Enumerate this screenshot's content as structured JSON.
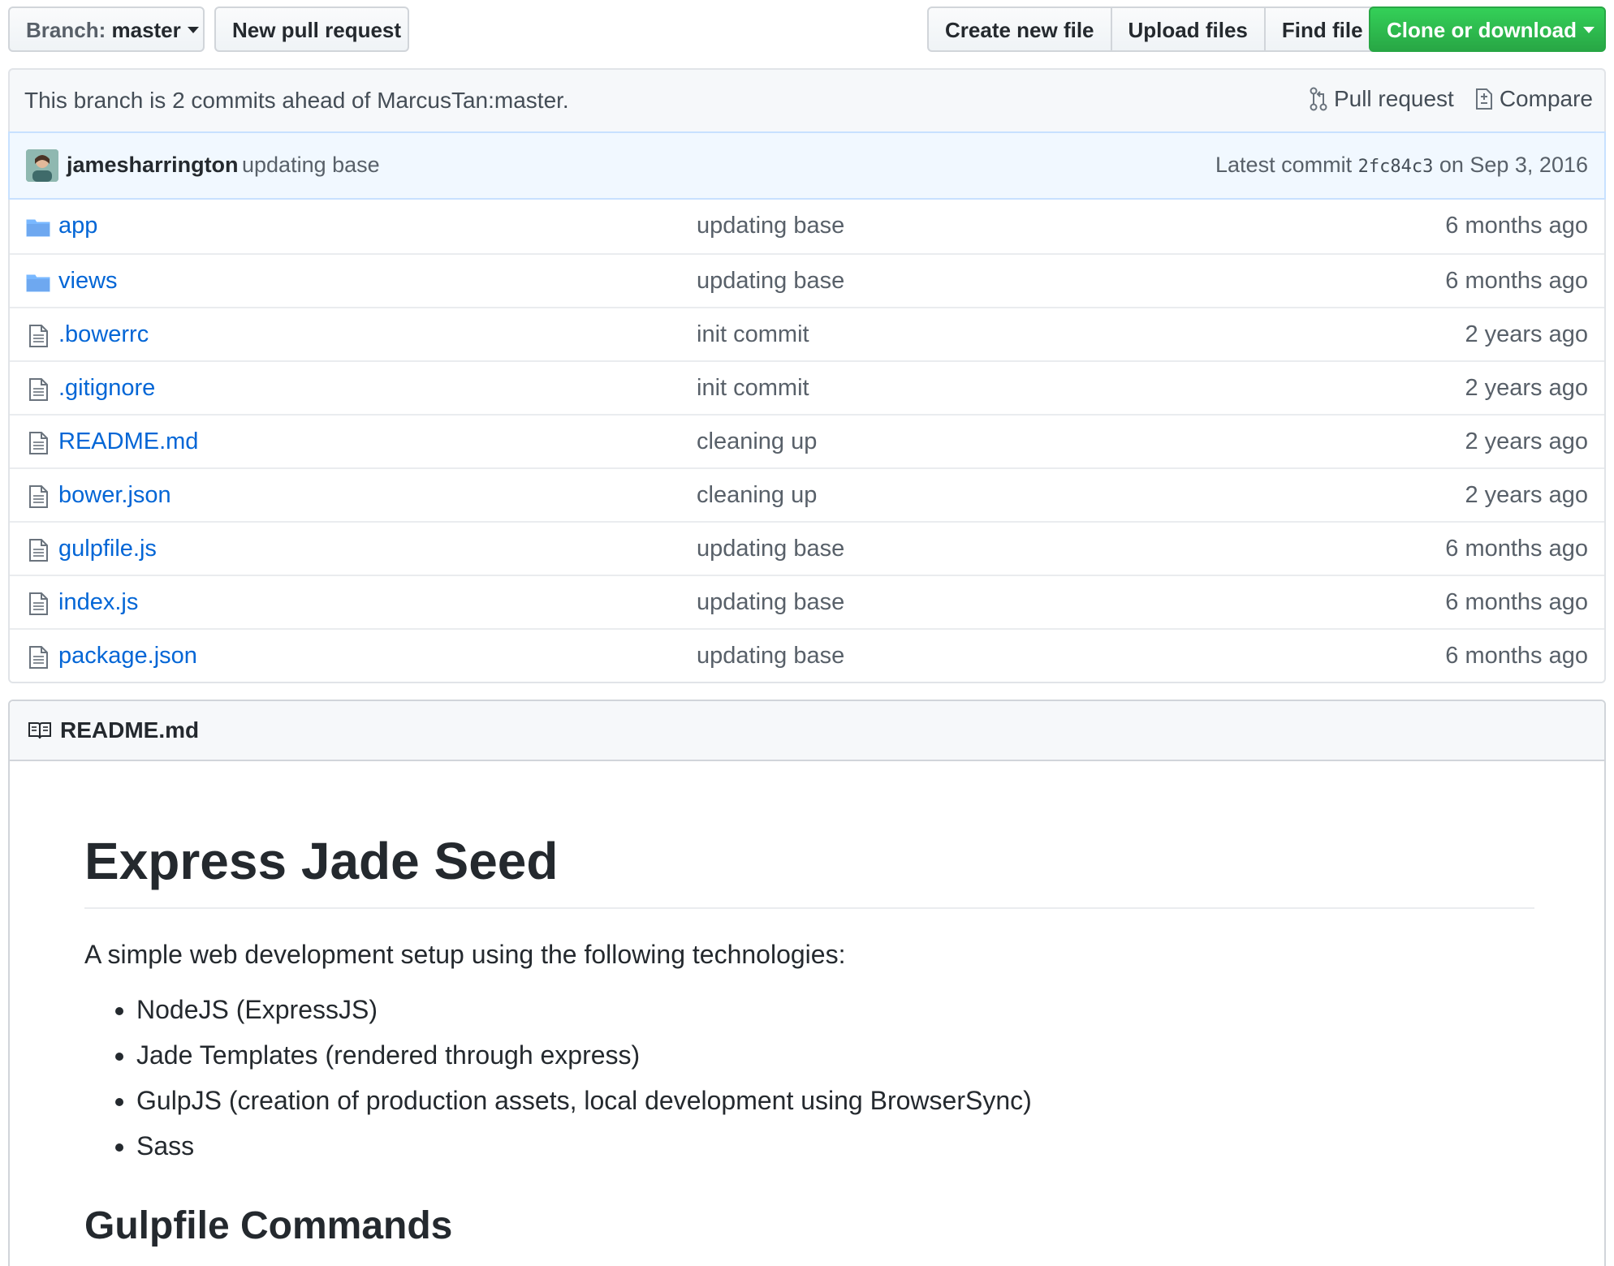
{
  "toolbar": {
    "branch_prefix": "Branch:",
    "branch_name": "master",
    "new_pull_request": "New pull request",
    "create_new_file": "Create new file",
    "upload_files": "Upload files",
    "find_file": "Find file",
    "clone_or_download": "Clone or download",
    "clone_color": "#28a745"
  },
  "compare": {
    "message": "This branch is 2 commits ahead of MarcusTan:master.",
    "pull_request": "Pull request",
    "compare": "Compare"
  },
  "commit": {
    "author": "jamesharrington",
    "message": "updating base",
    "latest_label": "Latest commit",
    "sha": "2fc84c3",
    "date": "on Sep 3, 2016"
  },
  "files": [
    {
      "type": "dir",
      "icon": "folder-icon",
      "name": "app",
      "message": "updating base",
      "age": "6 months ago"
    },
    {
      "type": "dir",
      "icon": "folder-icon",
      "name": "views",
      "message": "updating base",
      "age": "6 months ago"
    },
    {
      "type": "file",
      "icon": "file-icon",
      "name": ".bowerrc",
      "message": "init commit",
      "age": "2 years ago"
    },
    {
      "type": "file",
      "icon": "file-icon",
      "name": ".gitignore",
      "message": "init commit",
      "age": "2 years ago"
    },
    {
      "type": "file",
      "icon": "file-icon",
      "name": "README.md",
      "message": "cleaning up",
      "age": "2 years ago"
    },
    {
      "type": "file",
      "icon": "file-icon",
      "name": "bower.json",
      "message": "cleaning up",
      "age": "2 years ago"
    },
    {
      "type": "file",
      "icon": "file-icon",
      "name": "gulpfile.js",
      "message": "updating base",
      "age": "6 months ago"
    },
    {
      "type": "file",
      "icon": "file-icon",
      "name": "index.js",
      "message": "updating base",
      "age": "6 months ago"
    },
    {
      "type": "file",
      "icon": "file-icon",
      "name": "package.json",
      "message": "updating base",
      "age": "6 months ago"
    }
  ],
  "readme": {
    "filename": "README.md",
    "h1": "Express Jade Seed",
    "intro": "A simple web development setup using the following technologies:",
    "list": [
      "NodeJS (ExpressJS)",
      "Jade Templates (rendered through express)",
      "GulpJS (creation of production assets, local development using BrowserSync)",
      "Sass"
    ],
    "h2": "Gulpfile Commands"
  },
  "colors": {
    "link": "#0366d6",
    "folder": "#79b8ff"
  }
}
